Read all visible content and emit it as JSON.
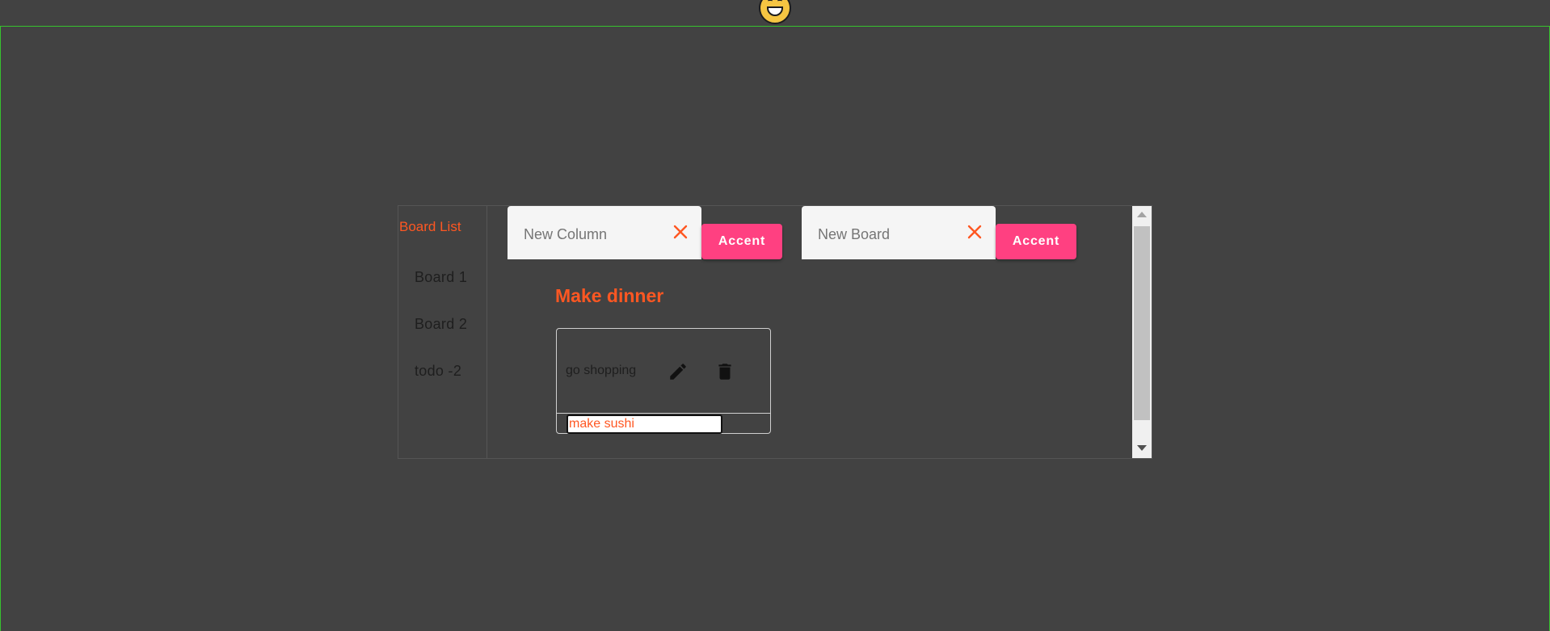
{
  "sidebar": {
    "title": "Board List",
    "items": [
      {
        "label": "Board 1"
      },
      {
        "label": "Board 2"
      },
      {
        "label": "todo -2"
      }
    ]
  },
  "new_column": {
    "placeholder": "New Column",
    "button_label": "Accent"
  },
  "new_board": {
    "placeholder": "New Board",
    "button_label": "Accent"
  },
  "column": {
    "title": "Make dinner",
    "tasks": [
      {
        "text": "go shopping"
      }
    ],
    "new_task_value": "make sushi"
  },
  "colors": {
    "accent": "#ff4081",
    "title": "#ff5722",
    "background": "#424242",
    "frame_border": "#37c22e"
  },
  "icons": [
    "grinning-emoji-icon",
    "close-icon",
    "edit-icon",
    "delete-icon"
  ]
}
